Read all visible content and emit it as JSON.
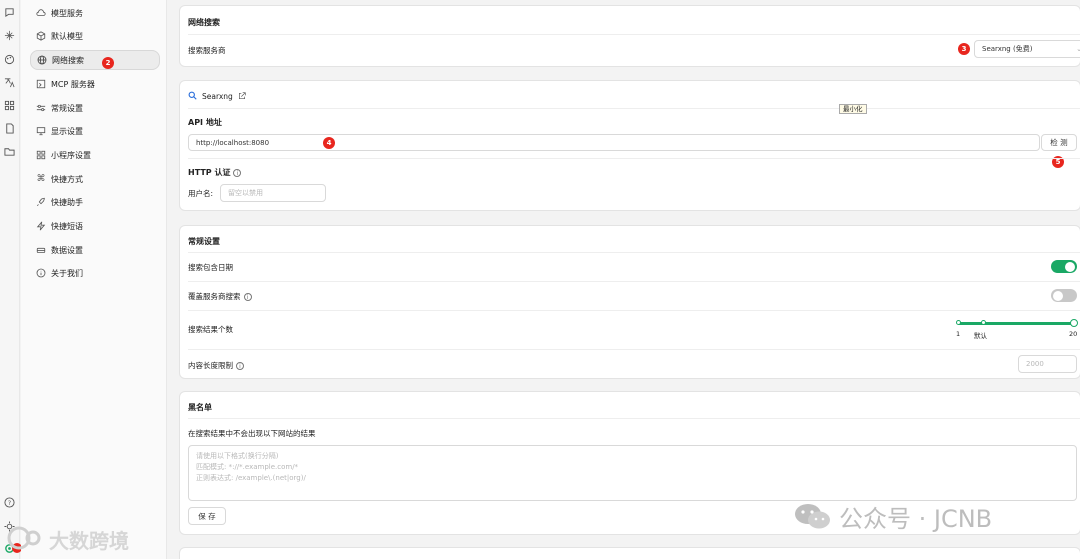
{
  "sidebar": {
    "items": [
      {
        "label": "模型服务",
        "icon": "cloud-icon"
      },
      {
        "label": "默认模型",
        "icon": "cube-icon"
      },
      {
        "label": "网络搜索",
        "icon": "globe-icon",
        "active": true
      },
      {
        "label": "MCP 服务器",
        "icon": "mcp-icon"
      },
      {
        "label": "常规设置",
        "icon": "sliders-icon"
      },
      {
        "label": "显示设置",
        "icon": "monitor-icon"
      },
      {
        "label": "小程序设置",
        "icon": "grid-icon"
      },
      {
        "label": "快捷方式",
        "icon": "command-icon"
      },
      {
        "label": "快捷助手",
        "icon": "rocket-icon"
      },
      {
        "label": "快捷短语",
        "icon": "zap-icon"
      },
      {
        "label": "数据设置",
        "icon": "hard-drive-icon"
      },
      {
        "label": "关于我们",
        "icon": "info-icon"
      }
    ]
  },
  "badges": {
    "b2": "2",
    "b3": "3",
    "b4": "4",
    "b5": "5"
  },
  "web_search": {
    "title": "网络搜索",
    "provider_label": "搜索服务商",
    "provider_value": "Searxng (免费)"
  },
  "searxng": {
    "name": "Searxng",
    "api_label": "API 地址",
    "api_value": "http://localhost:8080",
    "check_button": "检 测",
    "tooltip": "最小化",
    "http_auth_title": "HTTP 认证",
    "username_label": "用户名:",
    "username_placeholder": "留空以禁用"
  },
  "general": {
    "title": "常规设置",
    "include_date_label": "搜索包含日期",
    "include_date_on": true,
    "override_label": "覆盖服务商搜索",
    "override_on": false,
    "result_count_label": "搜索结果个数",
    "slider_min": "1",
    "slider_default": "默认",
    "slider_max": "20",
    "slider_value": 20,
    "content_limit_label": "内容长度限制",
    "content_limit_placeholder": "2000"
  },
  "blacklist": {
    "title": "黑名单",
    "description": "在搜索结果中不会出现以下网站的结果",
    "placeholder_lines": [
      "请使用以下格式(换行分隔)",
      "匹配模式: *://*.example.com/*",
      "正则表达式: /example\\.(net|org)/"
    ],
    "save_button": "保 存"
  },
  "watermark": {
    "left": "大数跨境",
    "right": "公众号 · JCNB"
  },
  "colors": {
    "accent": "#1aa865",
    "badge": "#e8261e",
    "link_blue": "#2c6fdb"
  }
}
